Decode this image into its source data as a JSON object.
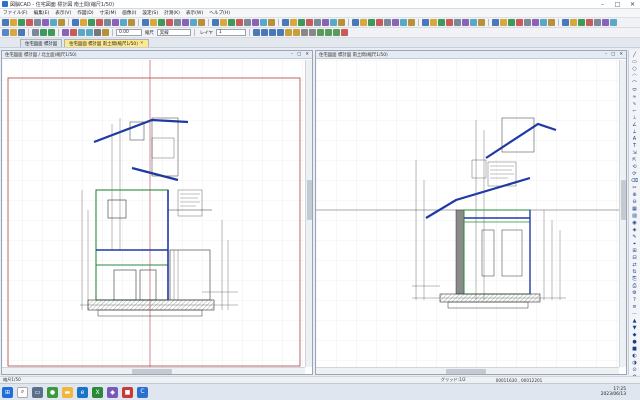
{
  "window": {
    "title": "図脳CAD  - 住宅図面 標計図   南土間(縮尺1/50)"
  },
  "menu": [
    "ファイル(F)",
    "編集(E)",
    "表示(V)",
    "作図(D)",
    "寸法(M)",
    "画像(I)",
    "設定(S)",
    "計測(K)",
    "表示(W)",
    "ヘルプ(H)"
  ],
  "toolbar2": {
    "scale_value": "0.00",
    "scale_label": "縮尺",
    "linetype": "実線",
    "layer_label": "レイヤ",
    "layer_value": "1"
  },
  "tabs": [
    {
      "label": "住宅図面 標計図",
      "active": false
    },
    {
      "label": "住宅図面 標計図   南土間(縮尺1/50)",
      "active": true
    }
  ],
  "panes": {
    "left_title": "住宅図面 標計図 / 北立面(縮尺1/50)",
    "right_title": "住宅図面 標計図   南土間(縮尺1/50)"
  },
  "status": {
    "left": "縮尺1/50",
    "mid": "グリッド:1/2",
    "coords": "00011630 , 00012201"
  },
  "taskbar": {
    "time": "17:25",
    "date": "2023/06/13"
  },
  "colors": {
    "accent": "#2b6fd0",
    "active_tab": "#ffe98a",
    "grid": "#dfe3e8",
    "drawing_blue": "#1f3aa6",
    "drawing_green": "#2a8a3a",
    "axis_red": "#c0394a"
  }
}
